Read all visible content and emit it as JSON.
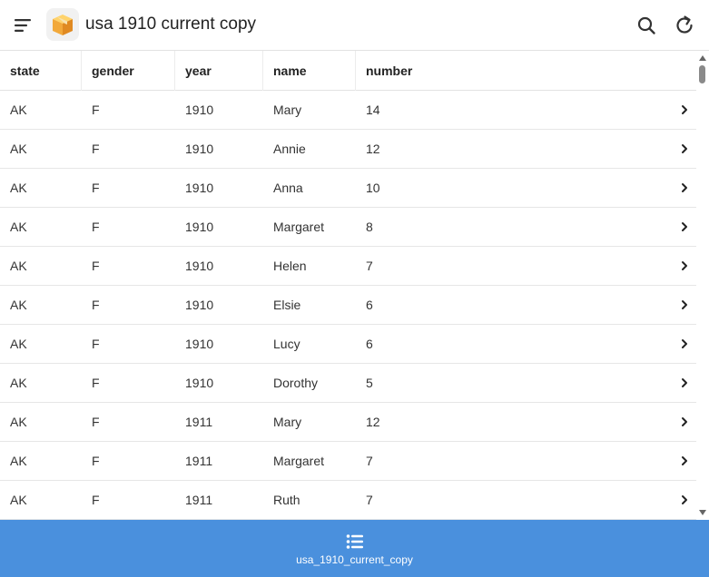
{
  "header": {
    "title": "usa 1910 current copy",
    "icons": {
      "menu": "menu-icon",
      "app": "package-box-icon",
      "search": "search-icon",
      "refresh": "refresh-icon"
    }
  },
  "table": {
    "columns": [
      "state",
      "gender",
      "year",
      "name",
      "number"
    ],
    "rows": [
      [
        "AK",
        "F",
        "1910",
        "Mary",
        "14"
      ],
      [
        "AK",
        "F",
        "1910",
        "Annie",
        "12"
      ],
      [
        "AK",
        "F",
        "1910",
        "Anna",
        "10"
      ],
      [
        "AK",
        "F",
        "1910",
        "Margaret",
        "8"
      ],
      [
        "AK",
        "F",
        "1910",
        "Helen",
        "7"
      ],
      [
        "AK",
        "F",
        "1910",
        "Elsie",
        "6"
      ],
      [
        "AK",
        "F",
        "1910",
        "Lucy",
        "6"
      ],
      [
        "AK",
        "F",
        "1910",
        "Dorothy",
        "5"
      ],
      [
        "AK",
        "F",
        "1911",
        "Mary",
        "12"
      ],
      [
        "AK",
        "F",
        "1911",
        "Margaret",
        "7"
      ],
      [
        "AK",
        "F",
        "1911",
        "Ruth",
        "7"
      ]
    ]
  },
  "bottom_nav": {
    "label": "usa_1910_current_copy",
    "icon": "list-icon"
  },
  "colors": {
    "accent": "#4a90dd",
    "text": "#2b2b2b",
    "divider": "#e2e2e2"
  }
}
